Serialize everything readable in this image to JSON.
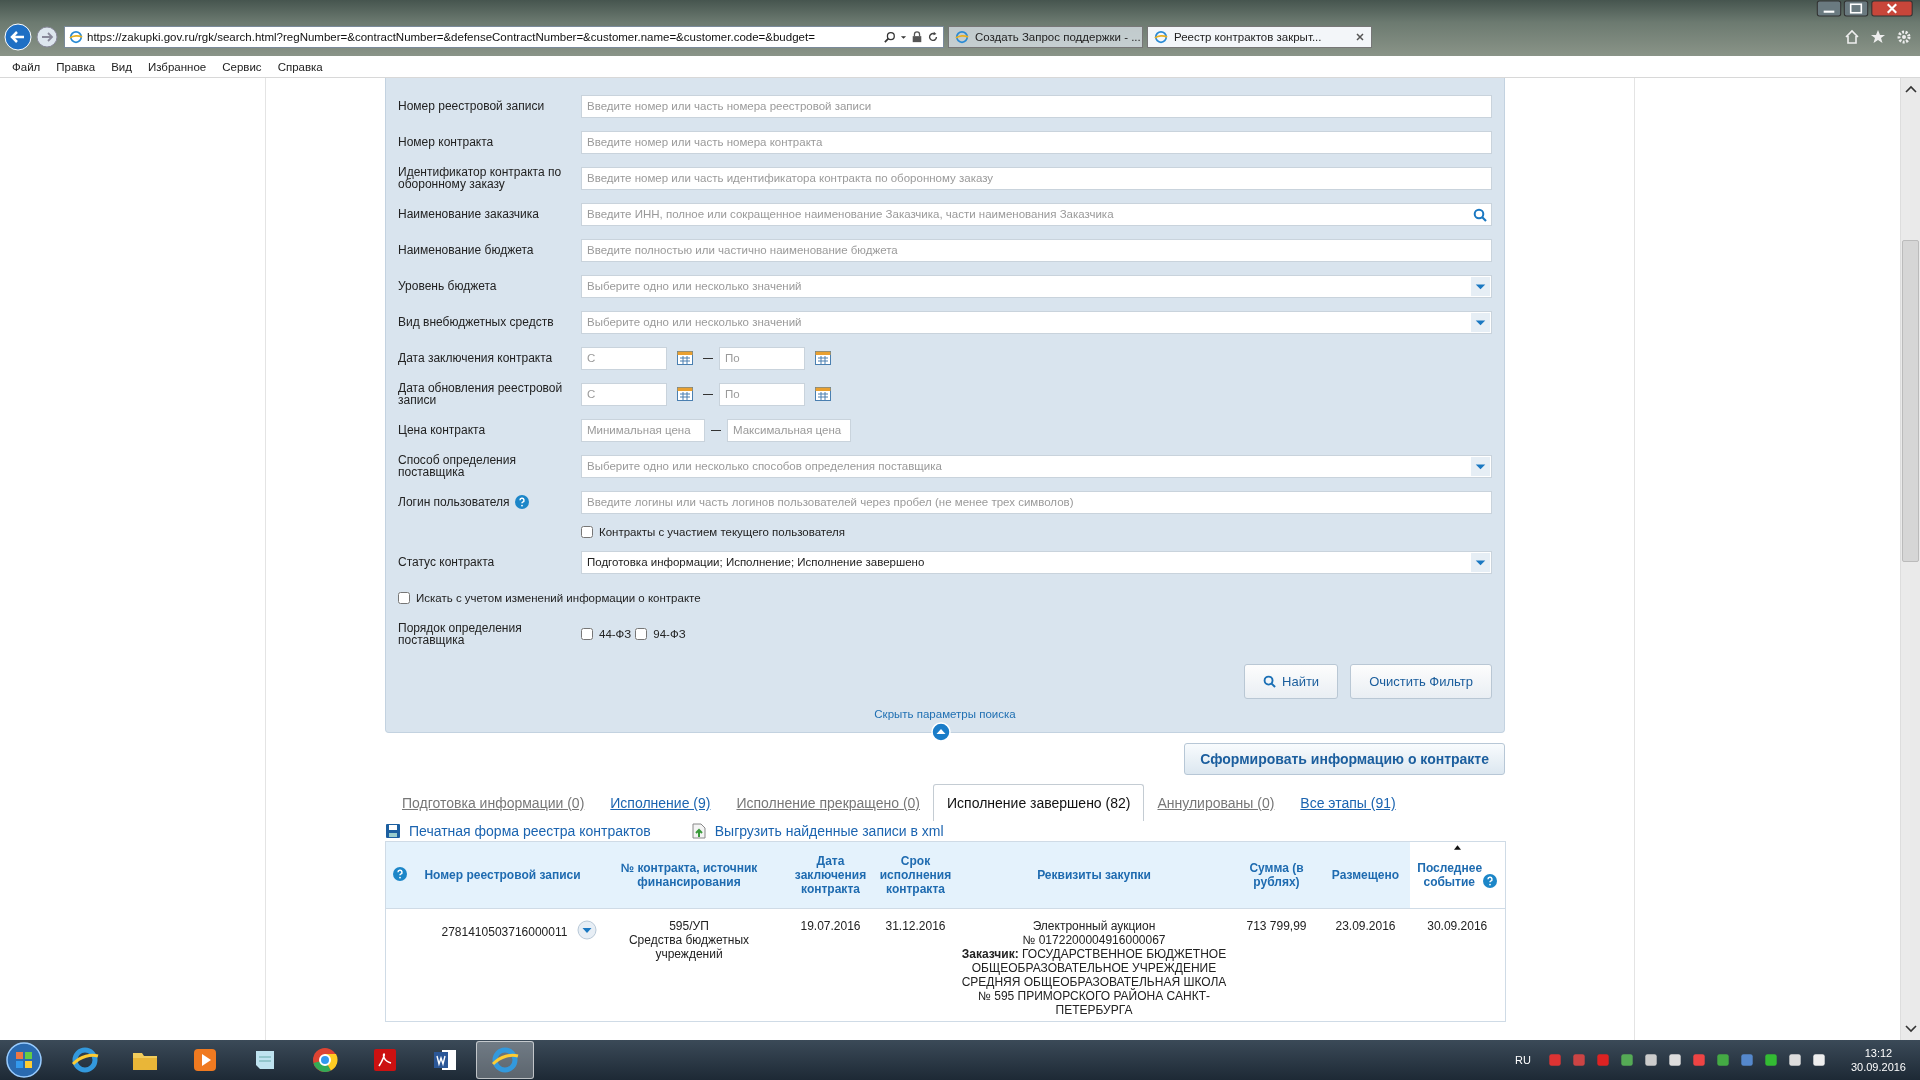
{
  "browser": {
    "url": "https://zakupki.gov.ru/rgk/search.html?regNumber=&contractNumber=&defenseContractNumber=&customer.name=&customer.code=&budget=",
    "tabs": [
      {
        "label": "Создать Запрос поддержки - ...",
        "selected": false
      },
      {
        "label": "Реестр контрактов закрыт...",
        "selected": true
      }
    ],
    "menu": [
      "Файл",
      "Правка",
      "Вид",
      "Избранное",
      "Сервис",
      "Справка"
    ]
  },
  "form": {
    "fields": [
      {
        "kind": "text",
        "label": "Номер реестровой записи",
        "placeholder": "Введите номер или часть номера реестровой записи"
      },
      {
        "kind": "text",
        "label": "Номер контракта",
        "placeholder": "Введите номер или часть номера контракта"
      },
      {
        "kind": "text",
        "label": "Идентификатор контракта по оборонному заказу",
        "placeholder": "Введите номер или часть идентификатора контракта по оборонному заказу"
      },
      {
        "kind": "search",
        "label": "Наименование заказчика",
        "placeholder": "Введите ИНН, полное или сокращенное наименование Заказчика, части наименования Заказчика"
      },
      {
        "kind": "text",
        "label": "Наименование бюджета",
        "placeholder": "Введите полностью или частично наименование бюджета"
      },
      {
        "kind": "select",
        "label": "Уровень бюджета",
        "placeholder": "Выберите одно или несколько значений"
      },
      {
        "kind": "select",
        "label": "Вид внебюджетных средств",
        "placeholder": "Выберите одно или несколько значений"
      },
      {
        "kind": "daterange",
        "label": "Дата заключения контракта",
        "from_placeholder": "С",
        "to_placeholder": "По"
      },
      {
        "kind": "daterange",
        "label": "Дата обновления реестровой записи",
        "from_placeholder": "С",
        "to_placeholder": "По"
      },
      {
        "kind": "range",
        "label": "Цена контракта",
        "from_placeholder": "Минимальная цена",
        "to_placeholder": "Максимальная цена"
      },
      {
        "kind": "select",
        "label": "Способ определения поставщика",
        "placeholder": "Выберите одно или несколько способов определения поставщика"
      },
      {
        "kind": "help_text",
        "label": "Логин пользователя",
        "placeholder": "Введите логины или часть логинов пользователей через пробел (не менее трех символов)"
      },
      {
        "kind": "checkbox",
        "label": "Контракты с участием текущего пользователя",
        "checked": false
      },
      {
        "kind": "select",
        "label": "Статус контракта",
        "value": "Подготовка информации; Исполнение; Исполнение завершено"
      },
      {
        "kind": "wide_checkbox",
        "label": "Искать с учетом изменений информации о контракте",
        "checked": false
      },
      {
        "kind": "checkgroup",
        "label": "Порядок определения поставщика",
        "options": [
          {
            "label": "44-ФЗ",
            "checked": false
          },
          {
            "label": "94-ФЗ",
            "checked": false
          }
        ]
      }
    ],
    "find_button": "Найти",
    "clear_button": "Очистить Фильтр",
    "hide_link": "Скрыть параметры поиска"
  },
  "generate_button": "Сформировать информацию о контракте",
  "result_tabs": [
    {
      "label": "Подготовка информации (0)",
      "selected": false,
      "disabled": true
    },
    {
      "label": "Исполнение (9)",
      "selected": false,
      "disabled": false
    },
    {
      "label": "Исполнение прекращено (0)",
      "selected": false,
      "disabled": true
    },
    {
      "label": "Исполнение завершено (82)",
      "selected": true,
      "disabled": false
    },
    {
      "label": "Аннулированы (0)",
      "selected": false,
      "disabled": true
    },
    {
      "label": "Все этапы (91)",
      "selected": false,
      "disabled": false
    }
  ],
  "actions": [
    {
      "kind": "print",
      "label": "Печатная форма реестра контрактов"
    },
    {
      "kind": "export",
      "label": "Выгрузить найденные записи в xml"
    }
  ],
  "table": {
    "columns": [
      {
        "kind": "help"
      },
      {
        "kind": "plain",
        "label": "Номер реестровой записи"
      },
      {
        "kind": "plain",
        "label": "№ контракта, источник финансирования"
      },
      {
        "kind": "plain",
        "label": "Дата заключения контракта"
      },
      {
        "kind": "plain",
        "label": "Срок исполнения контракта"
      },
      {
        "kind": "plain",
        "label": "Реквизиты закупки"
      },
      {
        "kind": "plain",
        "label": "Сумма (в рублях)"
      },
      {
        "kind": "plain",
        "label": "Размещено"
      },
      {
        "kind": "sorted",
        "label": "Последнее событие"
      }
    ],
    "rows": [
      {
        "registry_number": "2781410503716000011",
        "contract_number": "595/УП",
        "funding_source": "Средства бюджетных учреждений",
        "conclusion_date": "19.07.2016",
        "deadline": "31.12.2016",
        "procurement": [
          "Электронный аукцион",
          "№ 0172200004916000067",
          "**Заказчик:** ГОСУДАРСТВЕННОЕ БЮДЖЕТНОЕ ОБЩЕОБРАЗОВАТЕЛЬНОЕ УЧРЕЖДЕНИЕ СРЕДНЯЯ ОБЩЕОБРАЗОВАТЕЛЬНАЯ ШКОЛА № 595 ПРИМОРСКОГО РАЙОНА САНКТ-ПЕТЕРБУРГА"
        ],
        "amount": "713 799,99",
        "placed": "23.09.2016",
        "last_event": "30.09.2016"
      }
    ]
  },
  "taskbar": {
    "apps": [
      {
        "kind": "ie",
        "selected": false
      },
      {
        "kind": "folder",
        "selected": false
      },
      {
        "kind": "media",
        "selected": false
      },
      {
        "kind": "notes",
        "selected": false
      },
      {
        "kind": "chrome",
        "selected": false
      },
      {
        "kind": "pdf",
        "selected": false
      },
      {
        "kind": "word",
        "selected": false
      },
      {
        "kind": "ie",
        "selected": true
      }
    ],
    "language": "RU",
    "time": "13:12",
    "date": "30.09.2016"
  }
}
